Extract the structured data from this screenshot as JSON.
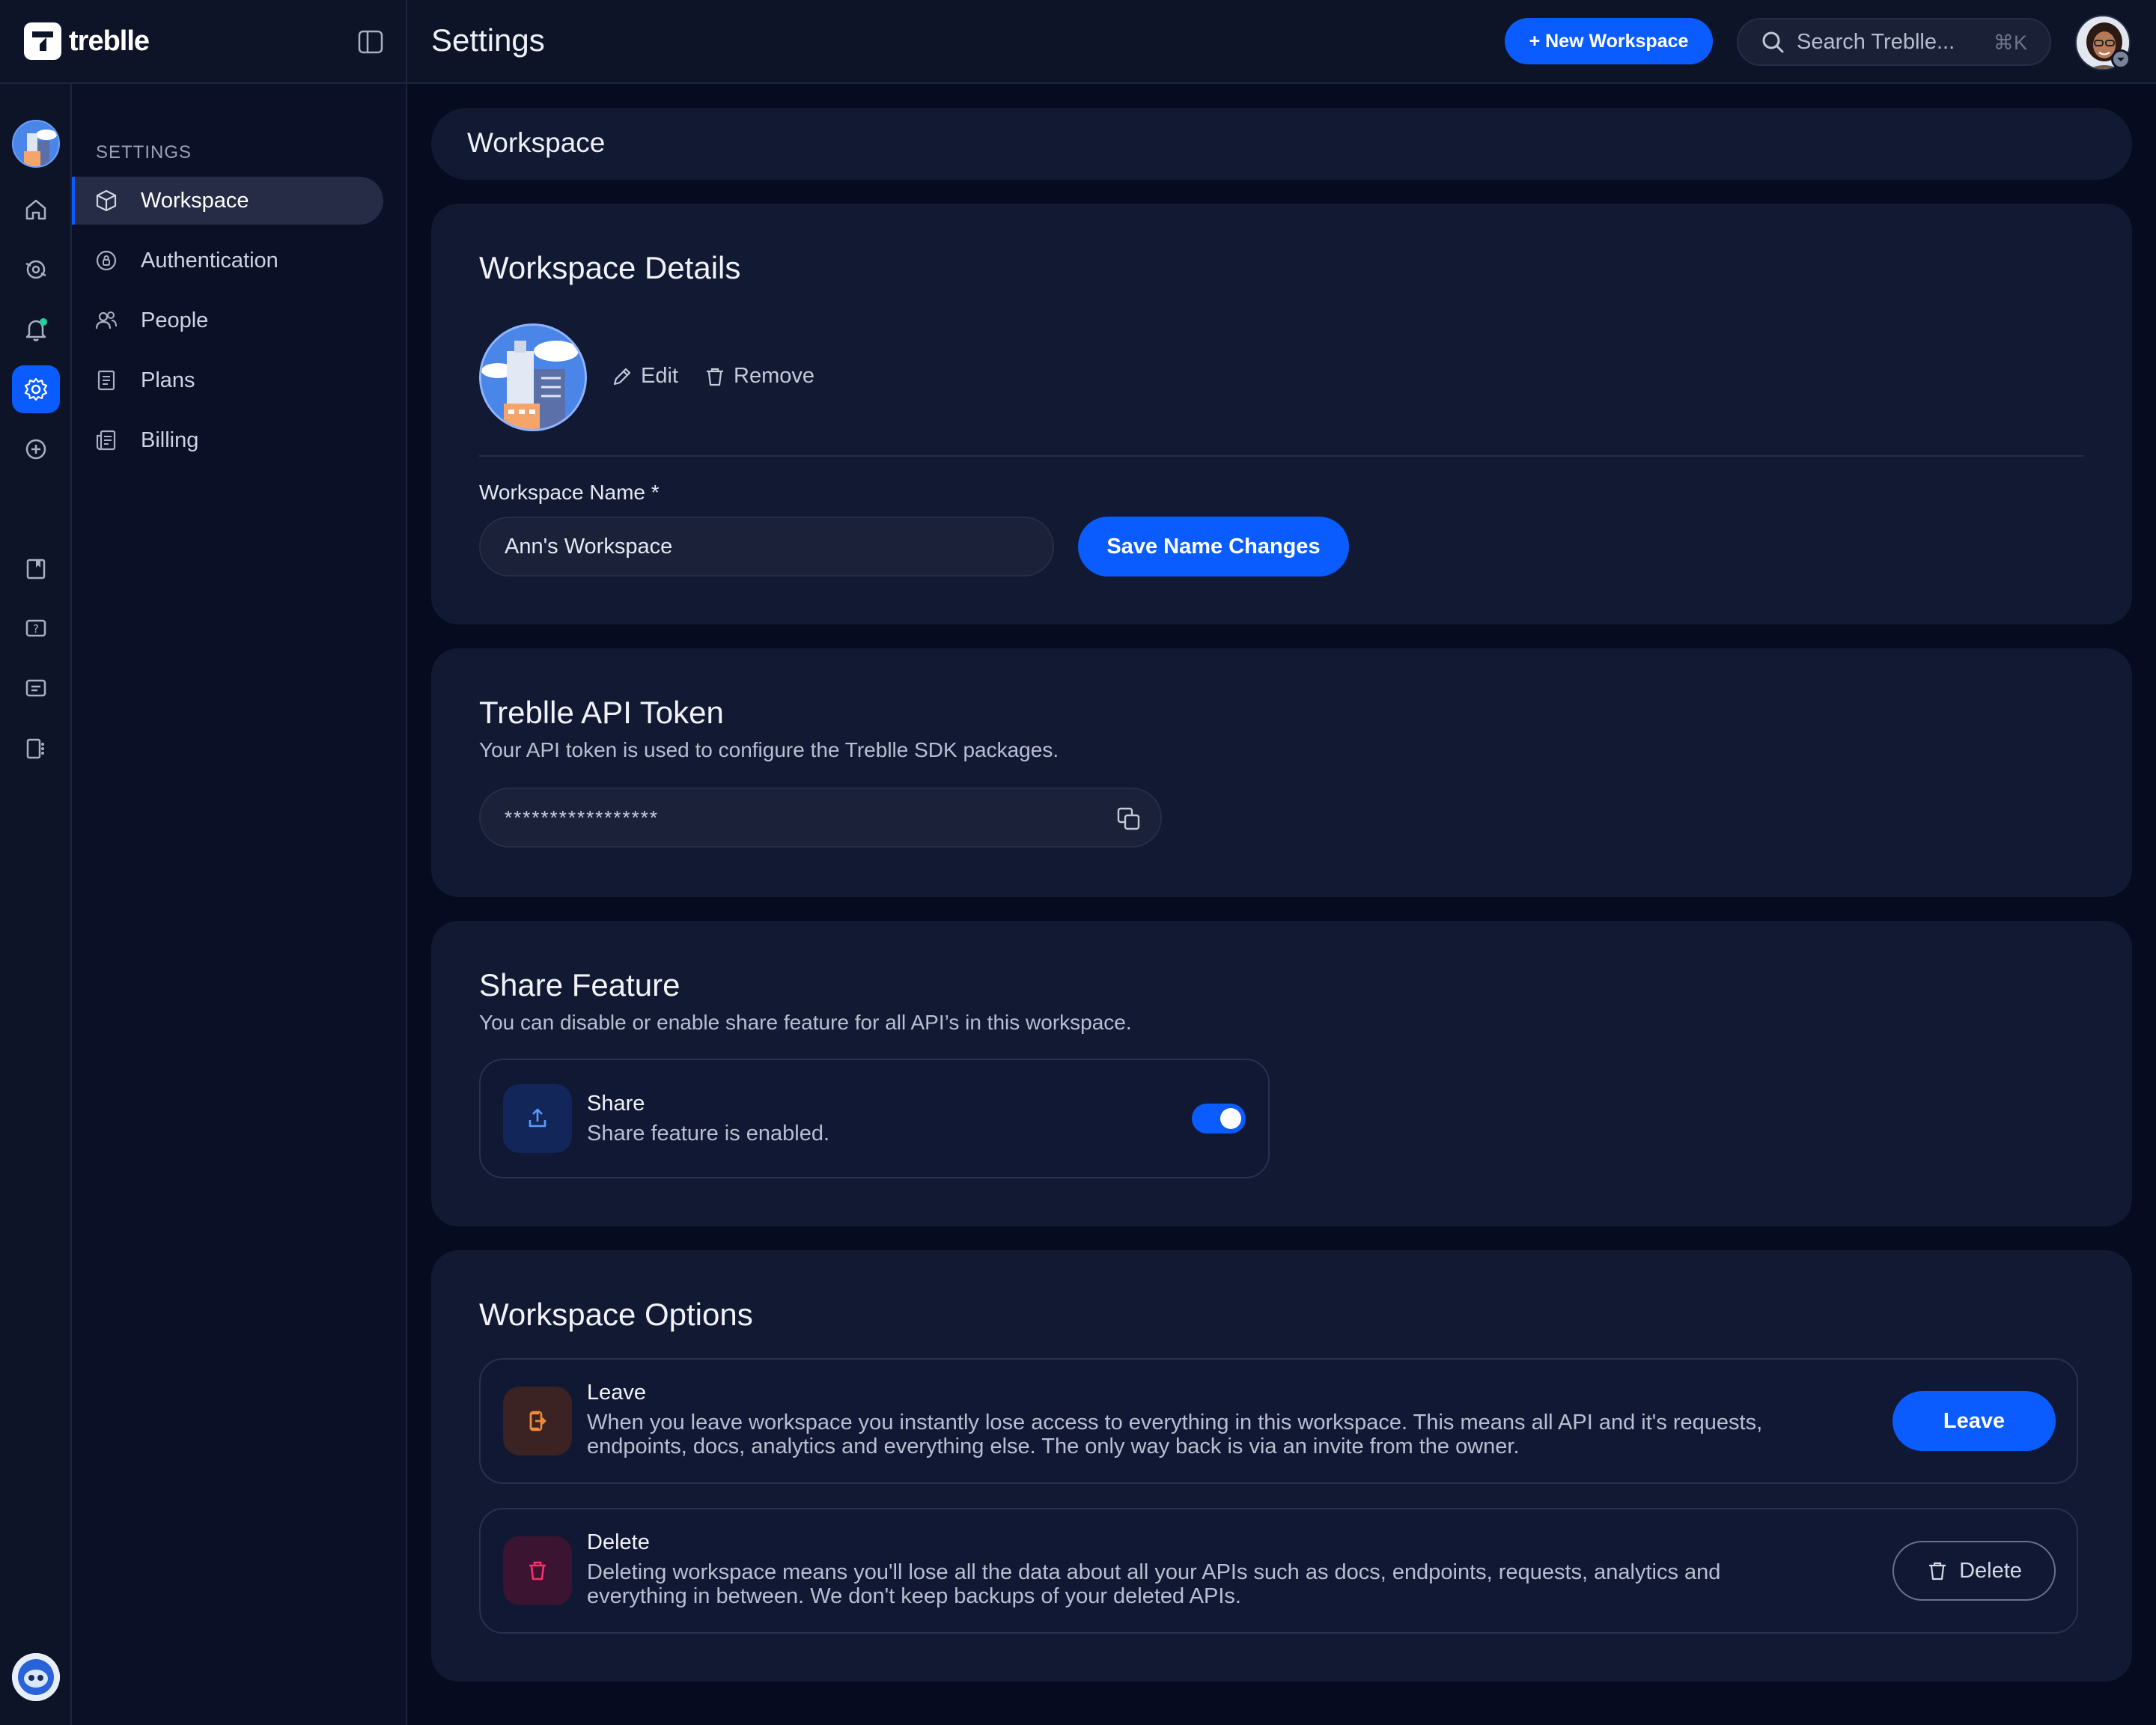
{
  "app": {
    "brand": "treblle",
    "page_title": "Settings"
  },
  "topbar": {
    "new_workspace_label": "+ New Workspace",
    "search_placeholder": "Search Treblle...",
    "search_shortcut": "⌘K"
  },
  "sidebar": {
    "heading": "SETTINGS",
    "items": [
      {
        "label": "Workspace",
        "icon": "cube-icon",
        "active": true
      },
      {
        "label": "Authentication",
        "icon": "shield-lock-icon",
        "active": false
      },
      {
        "label": "People",
        "icon": "people-icon",
        "active": false
      },
      {
        "label": "Plans",
        "icon": "document-list-icon",
        "active": false
      },
      {
        "label": "Billing",
        "icon": "receipt-icon",
        "active": false
      }
    ]
  },
  "rail": {
    "icons": [
      "home-icon",
      "api-icon",
      "bell-icon",
      "gear-icon",
      "plus-circle-icon",
      "bookmark-icon",
      "help-icon",
      "chat-icon",
      "grid-icon"
    ],
    "active": "gear-icon"
  },
  "main": {
    "header_title": "Workspace",
    "details": {
      "title": "Workspace Details",
      "edit_label": "Edit",
      "remove_label": "Remove",
      "name_label": "Workspace Name *",
      "name_value": "Ann's Workspace",
      "save_label": "Save Name Changes"
    },
    "token": {
      "title": "Treblle API Token",
      "description": "Your API token is used to configure the Treblle SDK packages.",
      "masked_value": "*****************"
    },
    "share": {
      "title": "Share Feature",
      "description": "You can disable or enable share feature for all API’s in this workspace.",
      "option_title": "Share",
      "option_status": "Share feature is enabled.",
      "enabled": true
    },
    "options": {
      "title": "Workspace Options",
      "leave": {
        "title": "Leave",
        "description_1": "When you leave workspace you instantly lose access to everything in this workspace. This means all API and it's requests,",
        "description_2": "endpoints, docs, analytics and everything else. The only way back is via an invite from the owner.",
        "button": "Leave"
      },
      "delete": {
        "title": "Delete",
        "description_1": "Deleting workspace means you'll lose all the data about all your APIs such as docs, endpoints, requests, analytics and",
        "description_2": "everything in between. We don't keep backups of your deleted APIs.",
        "button": "Delete"
      }
    }
  },
  "colors": {
    "accent": "#0a5cff",
    "background": "#060b1f",
    "card": "#121a33",
    "notification_dot": "#22d3a0"
  }
}
